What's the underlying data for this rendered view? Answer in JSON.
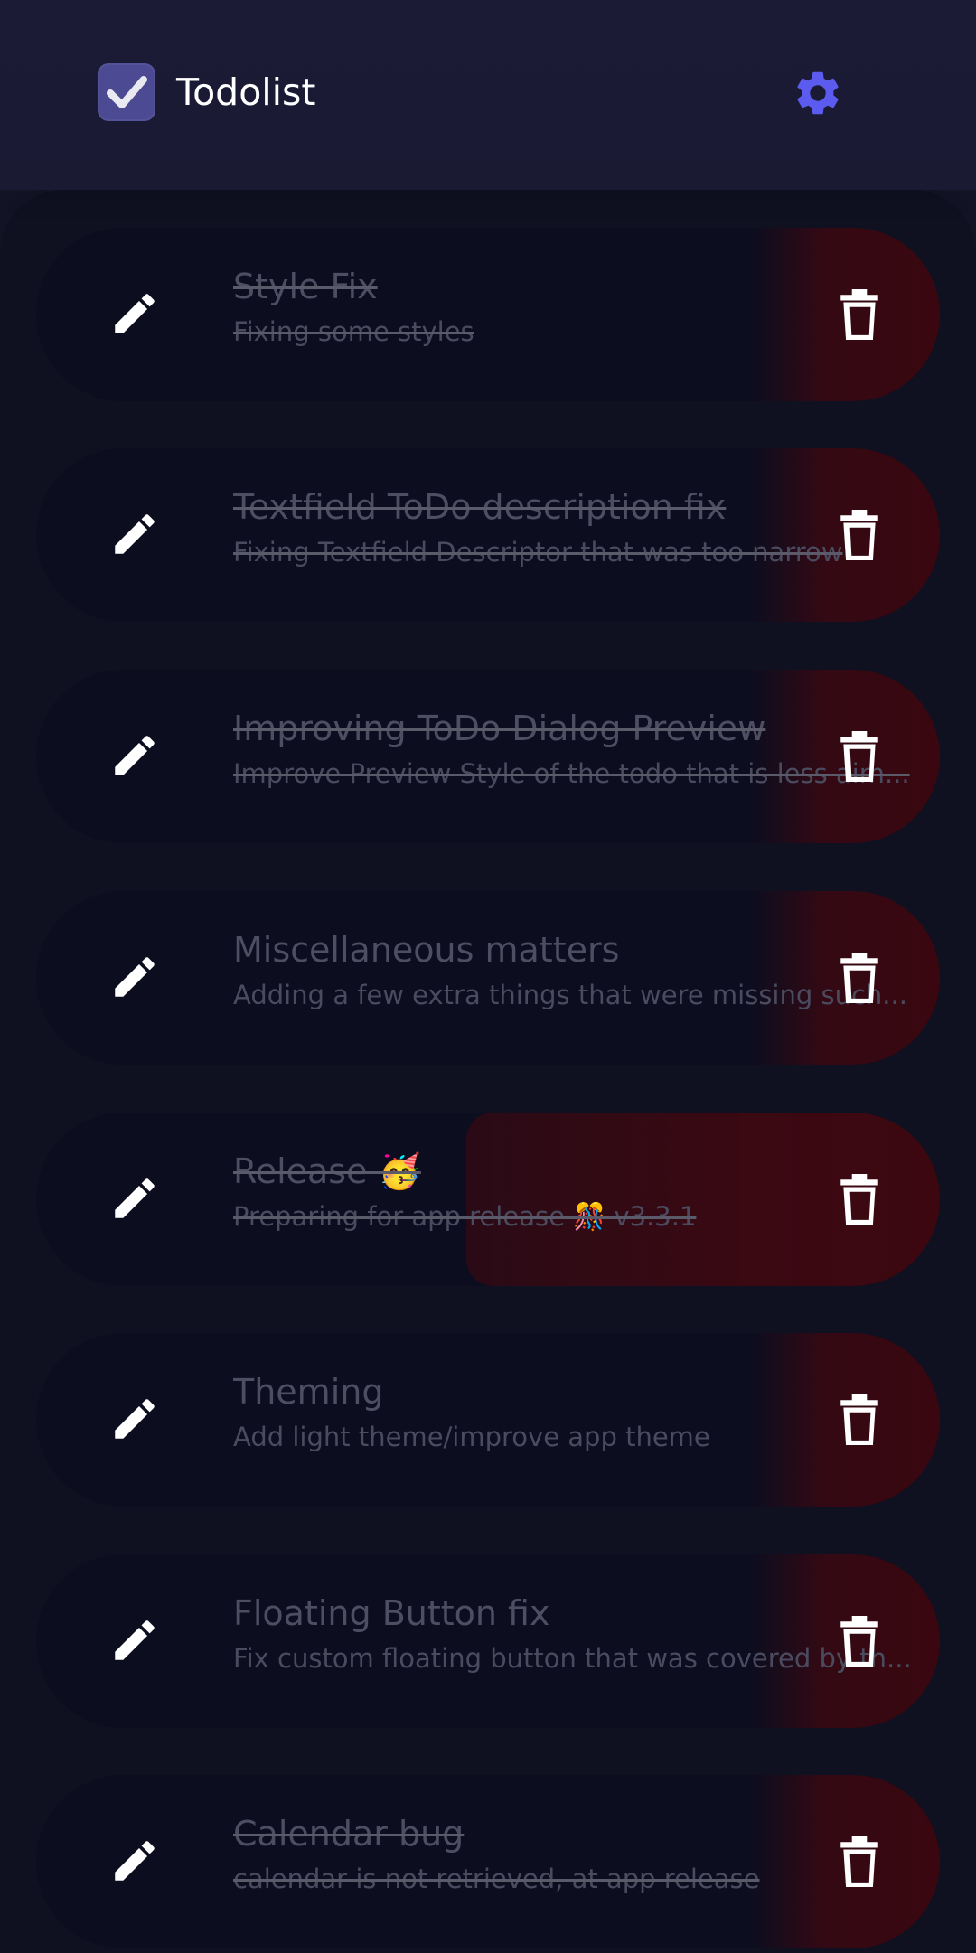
{
  "app": {
    "title": "Todolist",
    "colors": {
      "accent": "#5b5bef",
      "background": "#121325",
      "card": "#0c0d1f",
      "delete": "#3a0710"
    }
  },
  "todos": [
    {
      "title": "Style Fix",
      "description": "Fixing some styles",
      "completed": true
    },
    {
      "title": "Textfield ToDo description fix",
      "description": "Fixing Textfield Descriptor that was too narrow",
      "completed": true
    },
    {
      "title": "Improving ToDo Dialog Preview",
      "description": "Improve Preview Style of the todo that is less aim...",
      "completed": true
    },
    {
      "title": "Miscellaneous matters",
      "description": "Adding a few extra things that were missing such...",
      "completed": false
    },
    {
      "title": "Release 🥳",
      "description": "Preparing for app release 🎊 v3.3.1",
      "completed": true
    },
    {
      "title": "Theming",
      "description": "Add light theme/improve app theme",
      "completed": false
    },
    {
      "title": "Floating Button fix",
      "description": "Fix custom floating button that was covered by th...",
      "completed": false
    },
    {
      "title": "Calendar bug",
      "description": "calendar is not retrieved, at app release",
      "completed": true
    }
  ]
}
